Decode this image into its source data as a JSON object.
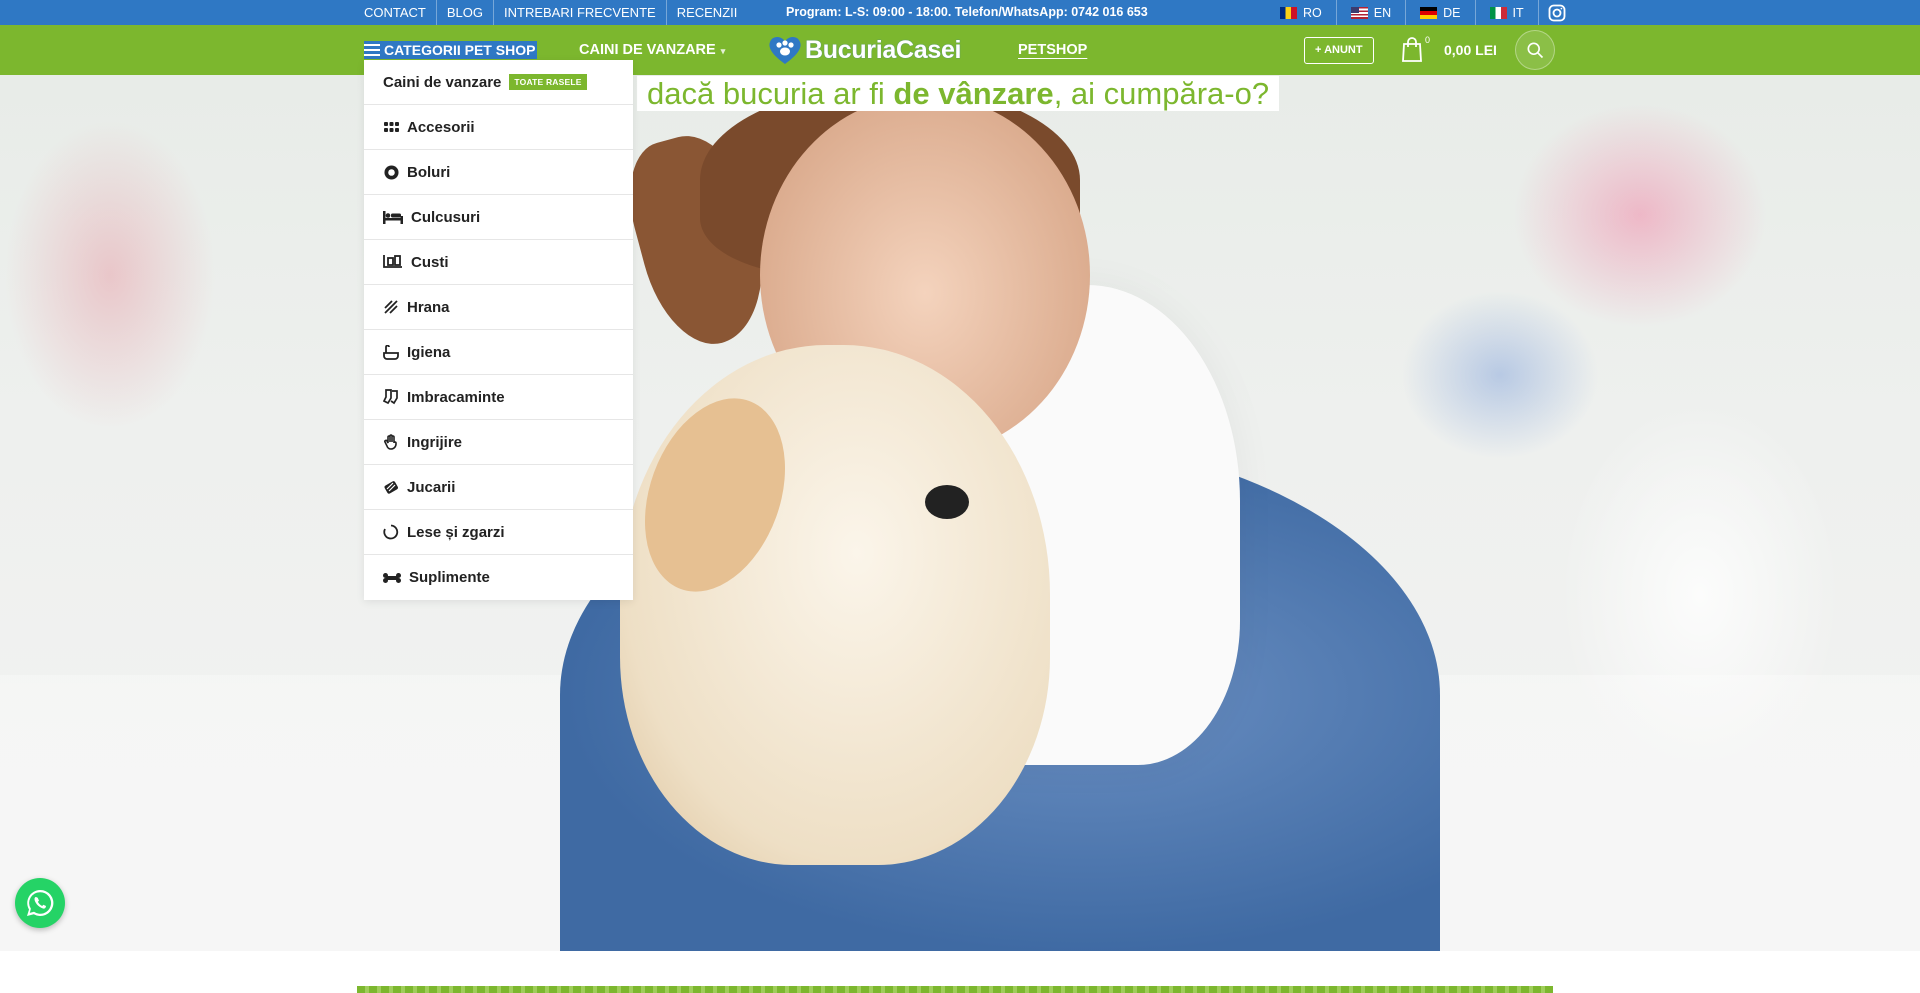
{
  "topbar": {
    "links": [
      "CONTACT",
      "BLOG",
      "INTREBARI FRECVENTE",
      "RECENZII"
    ],
    "program": "Program: L-S: 09:00 - 18:00. Telefon/WhatsApp: 0742 016 653",
    "languages": [
      "RO",
      "EN",
      "DE",
      "IT"
    ]
  },
  "nav": {
    "categories_label": "CATEGORII PET SHOP",
    "caini_label": "CAINI DE VANZARE",
    "logo_text": "BucuriaCasei",
    "petshop_label": "PETSHOP",
    "anunt_label": "+ ANUNT",
    "cart_count": "0",
    "cart_total": "0,00 LEI"
  },
  "hero": {
    "slogan_pre": "dacă bucuria ar fi ",
    "slogan_bold": "de vânzare",
    "slogan_post": ", ai cumpăra-o?"
  },
  "menu": {
    "first_label": "Caini de vanzare",
    "first_badge": "TOATE RASELE",
    "items": [
      "Accesorii",
      "Boluri",
      "Culcusuri",
      "Custi",
      "Hrana",
      "Igiena",
      "Imbracaminte",
      "Ingrijire",
      "Jucarii",
      "Lese și zgarzi",
      "Suplimente"
    ]
  },
  "colors": {
    "topbar": "#2f78c4",
    "navbar": "#7cb72e",
    "accent": "#7cb72e",
    "whatsapp": "#25d366"
  },
  "icons": {
    "menu": [
      "grid-icon",
      "bowl-icon",
      "bed-icon",
      "cage-icon",
      "food-icon",
      "bath-icon",
      "socks-icon",
      "hand-icon",
      "toy-icon",
      "leash-icon",
      "bone-icon"
    ]
  }
}
